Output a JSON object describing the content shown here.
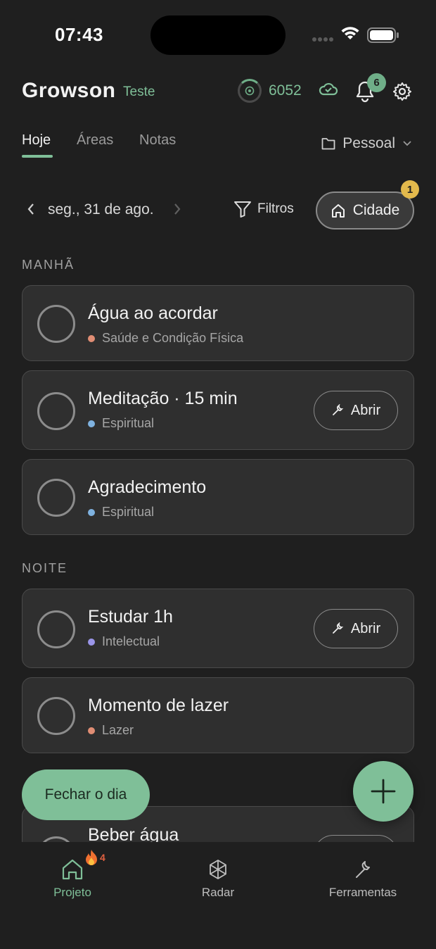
{
  "status_bar": {
    "time": "07:43"
  },
  "header": {
    "brand": "Growson",
    "tag": "Teste",
    "points": "6052",
    "notifications_count": "6"
  },
  "tabs": [
    {
      "label": "Hoje",
      "active": true
    },
    {
      "label": "Áreas",
      "active": false
    },
    {
      "label": "Notas",
      "active": false
    }
  ],
  "space_selector": {
    "value": "Pessoal"
  },
  "date_nav": {
    "date": "seg., 31 de ago."
  },
  "filters": {
    "label": "Filtros"
  },
  "city_filter": {
    "label": "Cidade",
    "badge": "1"
  },
  "sections": {
    "morning": "MANHÃ",
    "night": "NOITE"
  },
  "tasks": [
    {
      "title": "Água ao acordar",
      "category": "Saúde e Condição Física",
      "category_color": "#e08d74"
    },
    {
      "title": "Meditação · 15 min",
      "category": "Espiritual",
      "category_color": "#7fb2e0",
      "action": "Abrir"
    },
    {
      "title": "Agradecimento",
      "category": "Espiritual",
      "category_color": "#7fb2e0"
    },
    {
      "title": "Estudar 1h",
      "category": "Intelectual",
      "category_color": "#9a95e8",
      "action": "Abrir"
    },
    {
      "title": "Momento de lazer",
      "category": "Lazer",
      "category_color": "#e08d74"
    },
    {
      "title": "Beber água"
    }
  ],
  "close_day": {
    "label": "Fechar o dia"
  },
  "bottom_nav": [
    {
      "label": "Projeto",
      "icon": "home-icon",
      "active": true,
      "streak": "4"
    },
    {
      "label": "Radar",
      "icon": "radar-icon",
      "active": false
    },
    {
      "label": "Ferramentas",
      "icon": "wrench-icon",
      "active": false
    }
  ],
  "colors": {
    "accent": "#7fbf98",
    "background": "#1f1f1f",
    "card": "#2f2f2f",
    "badge_yellow": "#e3b94c"
  }
}
